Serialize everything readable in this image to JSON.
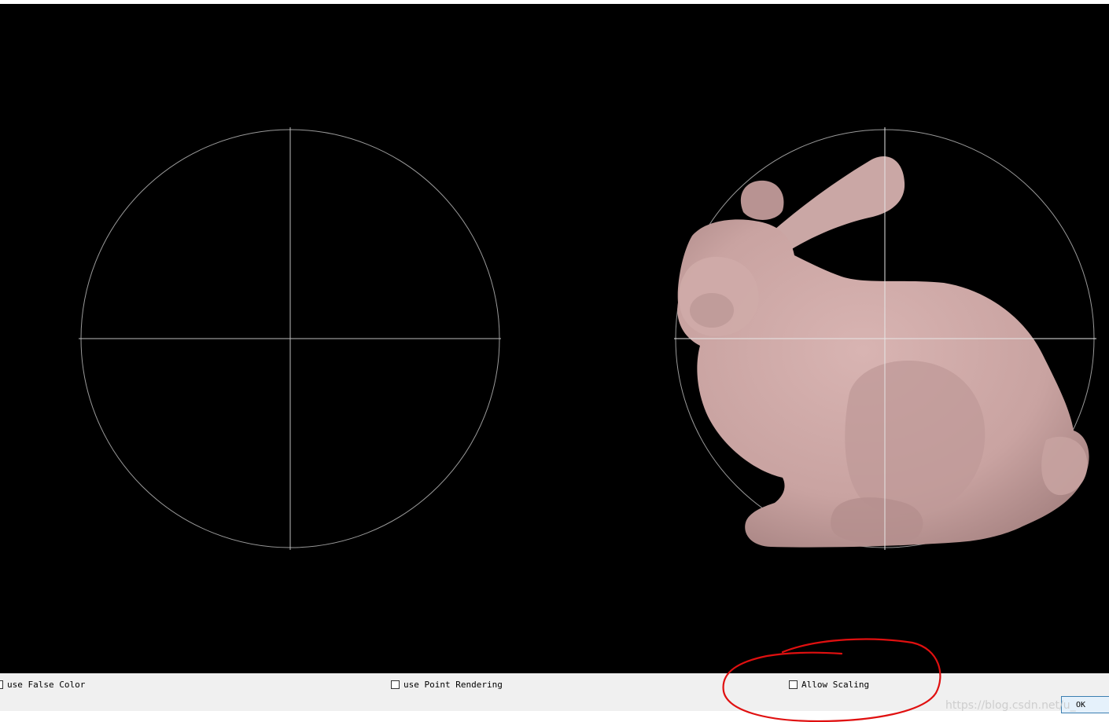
{
  "controls": {
    "use_false_color": {
      "label": "use False Color",
      "checked": false
    },
    "use_point_rendering": {
      "label": "use Point Rendering",
      "checked": false
    },
    "allow_scaling": {
      "label": "Allow Scaling",
      "checked": false
    }
  },
  "ok_button": {
    "label": "OK"
  },
  "watermark": "https://blog.csdn.net/u_"
}
